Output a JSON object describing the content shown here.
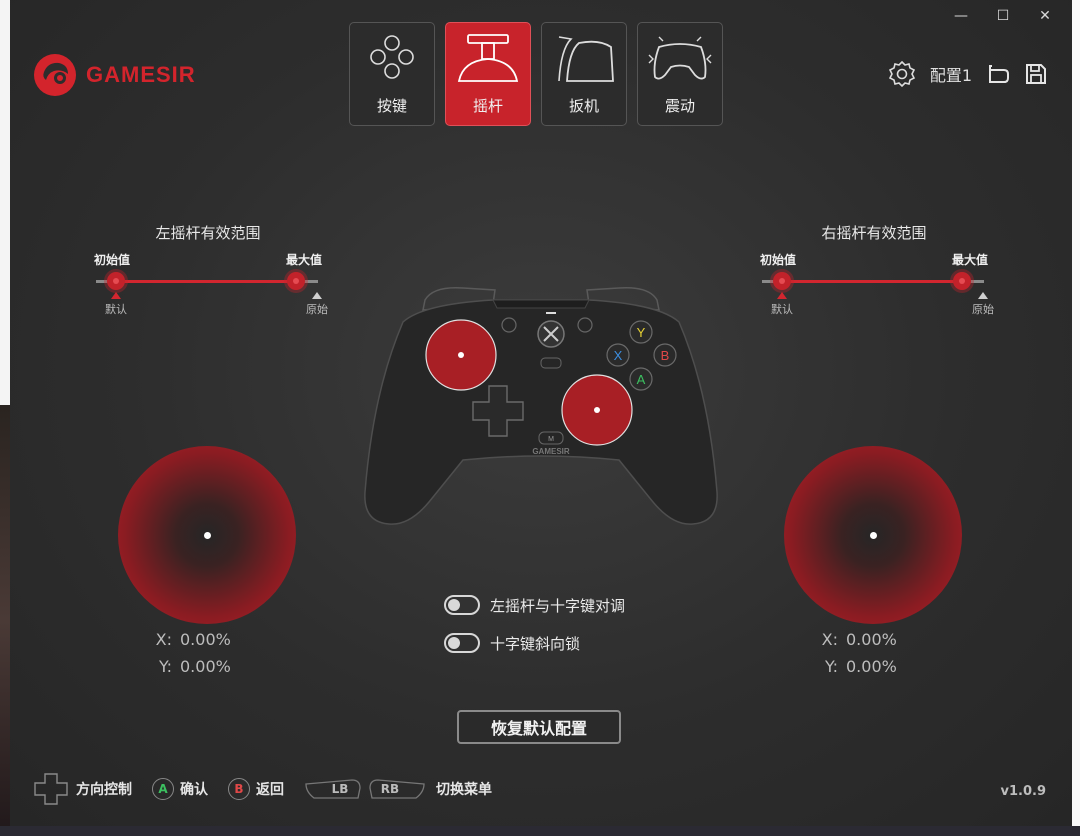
{
  "window": {
    "controls": [
      "—",
      "☐",
      "✕"
    ]
  },
  "brand": {
    "name": "GAMESIR",
    "color": "#d3242c"
  },
  "tabs": [
    {
      "label": "按键",
      "icon": "buttons-icon",
      "active": false
    },
    {
      "label": "摇杆",
      "icon": "joystick-icon",
      "active": true
    },
    {
      "label": "扳机",
      "icon": "trigger-icon",
      "active": false
    },
    {
      "label": "震动",
      "icon": "vibration-icon",
      "active": false
    }
  ],
  "config": {
    "name": "配置1"
  },
  "left_range": {
    "title": "左摇杆有效范围",
    "min_label": "初始值",
    "max_label": "最大值",
    "default_label": "默认",
    "original_label": "原始"
  },
  "right_range": {
    "title": "右摇杆有效范围",
    "min_label": "初始值",
    "max_label": "最大值",
    "default_label": "默认",
    "original_label": "原始"
  },
  "left_stick": {
    "x_label": "X:",
    "x_value": "0.00%",
    "y_label": "Y:",
    "y_value": "0.00%"
  },
  "right_stick": {
    "x_label": "X:",
    "x_value": "0.00%",
    "y_label": "Y:",
    "y_value": "0.00%"
  },
  "controller": {
    "brand_text": "GAMESIR",
    "buttons": {
      "y": "Y",
      "x": "X",
      "b": "B",
      "a": "A",
      "m": "M"
    }
  },
  "toggles": [
    {
      "label": "左摇杆与十字键对调",
      "on": false
    },
    {
      "label": "十字键斜向锁",
      "on": false
    }
  ],
  "reset_label": "恢复默认配置",
  "footer": {
    "dpad_label": "方向控制",
    "a_button": "A",
    "confirm_label": "确认",
    "b_button": "B",
    "back_label": "返回",
    "lb": "LB",
    "rb": "RB",
    "switch_label": "切换菜单"
  },
  "version": "v1.0.9",
  "colors": {
    "accent": "#c8232b",
    "background": "#2d2d2d"
  }
}
